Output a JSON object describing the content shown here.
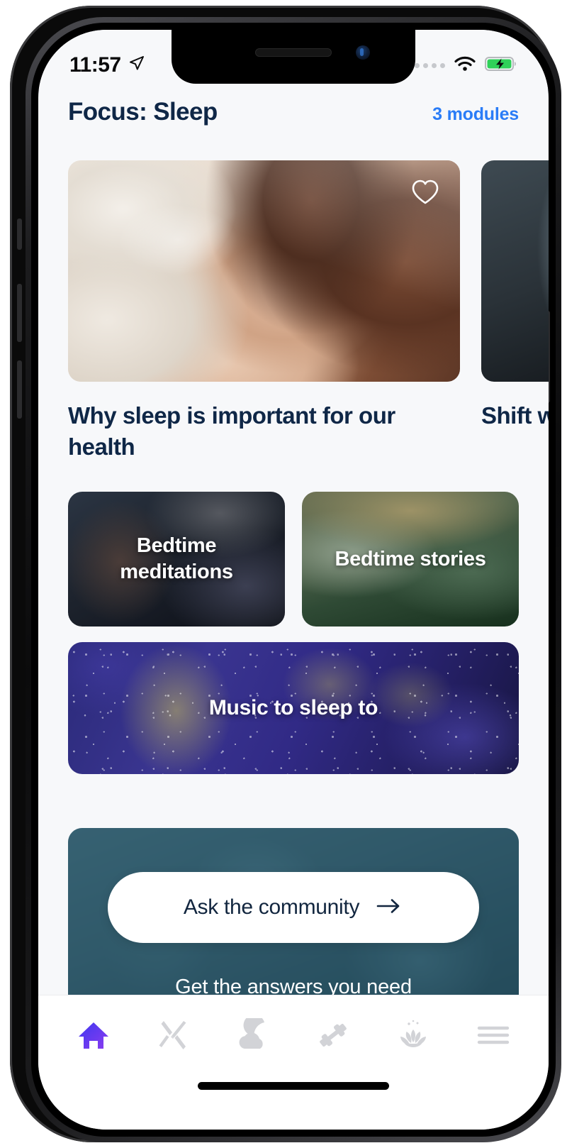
{
  "statusbar": {
    "time": "11:57",
    "location_icon": "location-arrow-icon",
    "cellular_icon": "cellular-dots-icon",
    "wifi_icon": "wifi-icon",
    "battery_icon": "battery-charging-icon"
  },
  "header": {
    "title": "Focus: Sleep",
    "modules_label": "3 modules"
  },
  "articles": [
    {
      "title": "Why sleep is important for our health",
      "favorite_icon": "heart-outline-icon",
      "image": "woman-sleeping-in-bed-photo"
    },
    {
      "title": "Shift work",
      "image": "dark-room-colored-lights-photo"
    }
  ],
  "tiles": [
    {
      "label": "Bedtime meditations",
      "image": "person-sleeping-dark-photo"
    },
    {
      "label": "Bedtime stories",
      "image": "misty-forest-photo"
    }
  ],
  "banner": {
    "label": "Music to sleep to",
    "image": "purple-starfield-nebula-photo"
  },
  "community": {
    "button_label": "Ask the community",
    "button_icon": "arrow-right-icon",
    "subtitle": "Get the answers you need",
    "image": "woman-resting-teal-tinted-photo"
  },
  "tabbar": {
    "items": [
      {
        "name": "home",
        "icon": "home-icon",
        "active": true
      },
      {
        "name": "nutrition",
        "icon": "cutlery-icon",
        "active": false
      },
      {
        "name": "sleep",
        "icon": "moon-cloud-icon",
        "active": false
      },
      {
        "name": "fitness",
        "icon": "dumbbell-icon",
        "active": false
      },
      {
        "name": "mindfulness",
        "icon": "lotus-icon",
        "active": false
      },
      {
        "name": "menu",
        "icon": "hamburger-icon",
        "active": false
      }
    ]
  },
  "colors": {
    "accent_blue": "#2a7cf7",
    "title_navy": "#0f2747",
    "background": "#f7f8fa",
    "active_tab": "#4b3cf0",
    "inactive_tab": "#d2d3d7",
    "community_teal": "#2f6073"
  }
}
